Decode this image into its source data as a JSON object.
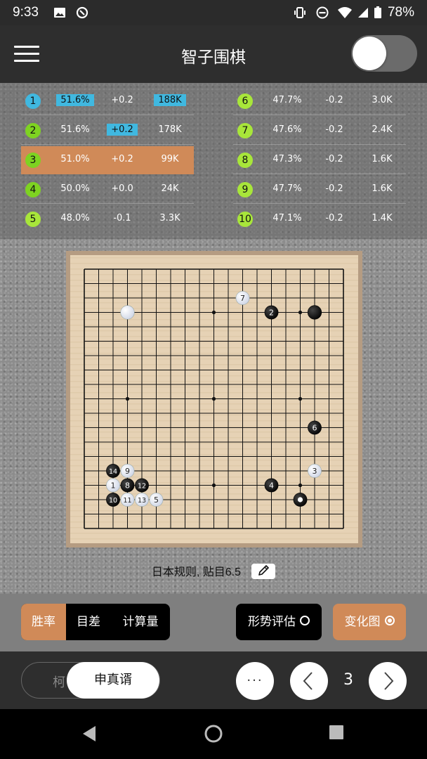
{
  "status_bar": {
    "time": "9:33",
    "battery": "78%"
  },
  "app": {
    "title": "智子围棋"
  },
  "candidates": [
    {
      "rank": "1",
      "winrate": "51.6%",
      "score": "+0.2",
      "visits": "188K",
      "color": "#40b8e0"
    },
    {
      "rank": "2",
      "winrate": "51.6%",
      "score": "+0.2",
      "visits": "178K",
      "color": "#7ed321"
    },
    {
      "rank": "3",
      "winrate": "51.0%",
      "score": "+0.2",
      "visits": "99K",
      "color": "#7ed321"
    },
    {
      "rank": "4",
      "winrate": "50.0%",
      "score": "+0.0",
      "visits": "24K",
      "color": "#7ed321"
    },
    {
      "rank": "5",
      "winrate": "48.0%",
      "score": "-0.1",
      "visits": "3.3K",
      "color": "#a8e63a"
    },
    {
      "rank": "6",
      "winrate": "47.7%",
      "score": "-0.2",
      "visits": "3.0K",
      "color": "#a8e63a"
    },
    {
      "rank": "7",
      "winrate": "47.6%",
      "score": "-0.2",
      "visits": "2.4K",
      "color": "#a8e63a"
    },
    {
      "rank": "8",
      "winrate": "47.3%",
      "score": "-0.2",
      "visits": "1.6K",
      "color": "#a8e63a"
    },
    {
      "rank": "9",
      "winrate": "47.7%",
      "score": "-0.2",
      "visits": "1.6K",
      "color": "#a8e63a"
    },
    {
      "rank": "10",
      "winrate": "47.1%",
      "score": "-0.2",
      "visits": "1.4K",
      "color": "#a8e63a"
    }
  ],
  "board": {
    "size": 19,
    "stones": [
      {
        "color": "white",
        "col": 3,
        "row": 3,
        "label": ""
      },
      {
        "color": "black",
        "col": 16,
        "row": 3,
        "label": ""
      },
      {
        "color": "black",
        "col": 13,
        "row": 3,
        "label": "2"
      },
      {
        "color": "white",
        "col": 11,
        "row": 2,
        "label": "7"
      },
      {
        "color": "black",
        "col": 16,
        "row": 11,
        "label": "6"
      },
      {
        "color": "white",
        "col": 16,
        "row": 14,
        "label": "3"
      },
      {
        "color": "black",
        "col": 13,
        "row": 15,
        "label": "4"
      },
      {
        "color": "black",
        "col": 15,
        "row": 16,
        "label": "●"
      },
      {
        "color": "black",
        "col": 2,
        "row": 14,
        "label": "14"
      },
      {
        "color": "white",
        "col": 3,
        "row": 14,
        "label": "9"
      },
      {
        "color": "white",
        "col": 2,
        "row": 15,
        "label": "1"
      },
      {
        "color": "black",
        "col": 3,
        "row": 15,
        "label": "8"
      },
      {
        "color": "black",
        "col": 4,
        "row": 15,
        "label": "12"
      },
      {
        "color": "black",
        "col": 2,
        "row": 16,
        "label": "10"
      },
      {
        "color": "white",
        "col": 3,
        "row": 16,
        "label": "11"
      },
      {
        "color": "white",
        "col": 4,
        "row": 16,
        "label": "13"
      },
      {
        "color": "white",
        "col": 5,
        "row": 16,
        "label": "5"
      }
    ]
  },
  "rules_text": "日本规则, 贴目6.5",
  "mode_tabs": [
    "胜率",
    "目差",
    "计算量"
  ],
  "mode_selected": 0,
  "situation_button": "形势评估",
  "variation_button": "变化图",
  "player_switch": {
    "left": "柯",
    "right": "申真谞"
  },
  "more_button": "···",
  "move_number": "3",
  "icons": {
    "menu": "menu-icon",
    "edit": "pencil-icon",
    "prev": "chevron-left-icon",
    "next": "chevron-right-icon",
    "back": "back-triangle-icon",
    "home": "home-circle-icon",
    "recents": "recents-square-icon"
  },
  "colors": {
    "accent": "#d08a58",
    "highlight": "#40b8e0",
    "board_wood": "#e7d4b8"
  }
}
